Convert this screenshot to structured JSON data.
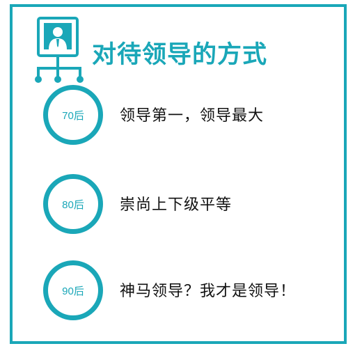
{
  "title": "对待领导的方式",
  "accent_color": "#1aa7b8",
  "header_icon": "person-org-chart-icon",
  "items": [
    {
      "generation": "70后",
      "text": "领导第一，领导最大"
    },
    {
      "generation": "80后",
      "text": "崇尚上下级平等"
    },
    {
      "generation": "90后",
      "text": "神马领导？我才是领导！"
    }
  ]
}
